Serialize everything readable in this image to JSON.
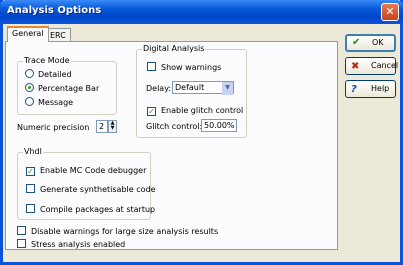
{
  "window": {
    "title": "Analysis Options"
  },
  "tabs": [
    {
      "label": "General"
    },
    {
      "label": "ERC"
    }
  ],
  "trace_mode": {
    "legend": "Trace Mode",
    "options": [
      {
        "label": "Detailed"
      },
      {
        "label": "Percentage Bar"
      },
      {
        "label": "Message"
      }
    ],
    "selected": "Percentage Bar"
  },
  "numeric_precision": {
    "label": "Numeric precision",
    "value": "2"
  },
  "digital_analysis": {
    "legend": "Digital Analysis",
    "show_warnings_label": "Show warnings",
    "delay_label": "Delay:",
    "delay_value": "Default",
    "enable_glitch_label": "Enable glitch control",
    "glitch_control_label": "Glitch control:",
    "glitch_control_value": "50.00%"
  },
  "vhdl": {
    "legend": "Vhdl",
    "enable_debugger_label": "Enable MC Code debugger",
    "generate_synth_label": "Generate synthetisable code",
    "compile_startup_label": "Compile packages at startup"
  },
  "disable_warnings_label": "Disable warnings for large size analysis results",
  "stress_analysis_label": "Stress analysis enabled",
  "buttons": {
    "ok": "OK",
    "cancel": "Cancel",
    "help": "Help"
  },
  "icons": {
    "ok": "checkmark-icon",
    "cancel": "red-x-icon",
    "help": "question-mark-icon",
    "close": "close-icon"
  }
}
